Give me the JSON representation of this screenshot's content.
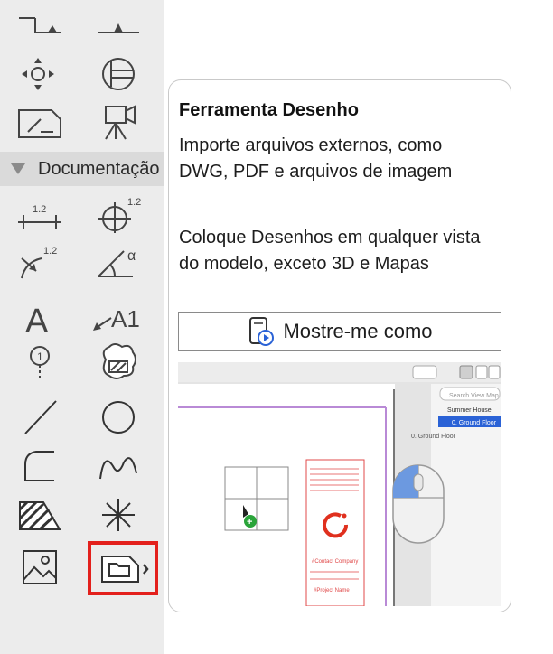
{
  "toolbox": {
    "section_label": "Documentação",
    "text_tool_glyph": "A",
    "label_tool_glyph": "A1",
    "dimension_number": "1.2",
    "angle_symbol": "α"
  },
  "tooltip": {
    "title": "Ferramenta Desenho",
    "description": "Importe arquivos externos, como DWG, PDF e arquivos de imagem",
    "placement_note": "Coloque Desenhos em qualquer vista do modelo, exceto 3D e Mapas",
    "show_me_button": "Mostre-me como",
    "preview": {
      "search_placeholder": "Search View Map",
      "tree_items": [
        "Summer House",
        "0. Ground Floor"
      ],
      "floor_label": "0. Ground Floor",
      "company": "#Contact Company",
      "project": "#Project Name"
    }
  },
  "colors": {
    "selection": "#e3201c",
    "accent_blue": "#2a62d6"
  }
}
